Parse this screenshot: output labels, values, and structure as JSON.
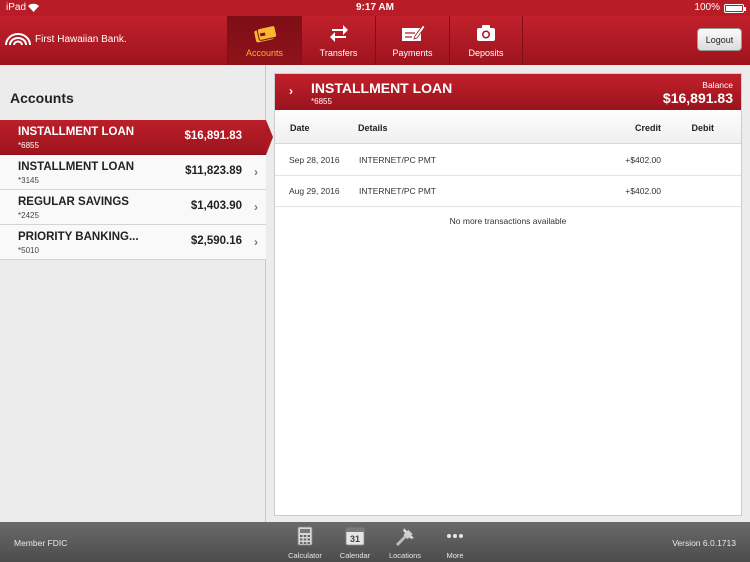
{
  "status_bar": {
    "carrier": "iPad",
    "time": "9:17 AM",
    "battery": "100%"
  },
  "header": {
    "brand": "First Hawaiian Bank.",
    "nav": [
      {
        "label": "Accounts",
        "icon": "accounts-icon",
        "active": true
      },
      {
        "label": "Transfers",
        "icon": "transfers-icon",
        "active": false
      },
      {
        "label": "Payments",
        "icon": "payments-icon",
        "active": false
      },
      {
        "label": "Deposits",
        "icon": "deposits-icon",
        "active": false
      }
    ],
    "logout_label": "Logout"
  },
  "sidebar": {
    "title": "Accounts",
    "accounts": [
      {
        "name": "INSTALLMENT LOAN",
        "number": "*6855",
        "balance": "$16,891.83",
        "selected": true
      },
      {
        "name": "INSTALLMENT LOAN",
        "number": "*3145",
        "balance": "$11,823.89",
        "selected": false
      },
      {
        "name": "REGULAR SAVINGS",
        "number": "*2425",
        "balance": "$1,403.90",
        "selected": false
      },
      {
        "name": "PRIORITY BANKING...",
        "number": "*5010",
        "balance": "$2,590.16",
        "selected": false
      }
    ]
  },
  "detail": {
    "title": "INSTALLMENT LOAN",
    "number": "*6855",
    "balance_label": "Balance",
    "balance": "$16,891.83",
    "columns": {
      "date": "Date",
      "details": "Details",
      "credit": "Credit",
      "debit": "Debit"
    },
    "transactions": [
      {
        "date": "Sep 28, 2016",
        "details": "INTERNET/PC PMT",
        "credit": "+$402.00",
        "debit": ""
      },
      {
        "date": "Aug 29, 2016",
        "details": "INTERNET/PC PMT",
        "credit": "+$402.00",
        "debit": ""
      }
    ],
    "no_more": "No more transactions available"
  },
  "footer": {
    "member": "Member FDIC",
    "version": "Version 6.0.1713",
    "tools": [
      {
        "label": "Calculator",
        "icon": "calculator-icon"
      },
      {
        "label": "Calendar",
        "icon": "calendar-icon",
        "day": "31"
      },
      {
        "label": "Locations",
        "icon": "locations-icon"
      },
      {
        "label": "More",
        "icon": "more-icon"
      }
    ]
  },
  "colors": {
    "brand_red": "#b81c26",
    "active_nav_text": "#f7b733",
    "footer_gray": "#5a5a5a"
  }
}
